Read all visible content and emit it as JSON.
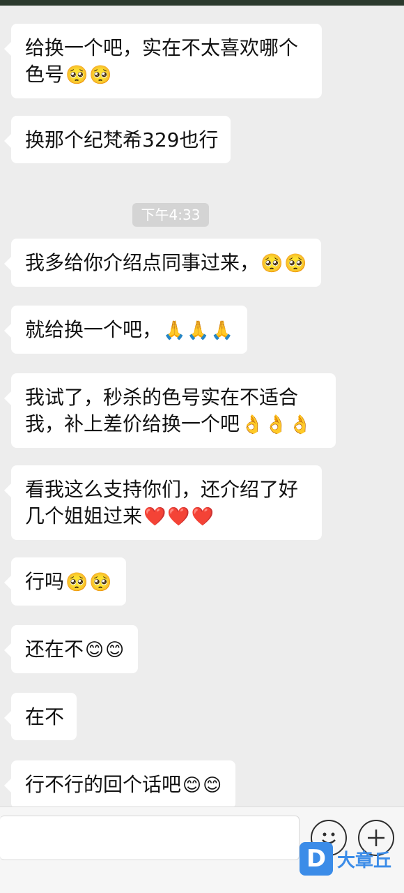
{
  "timestamp": "下午4:33",
  "messages": [
    {
      "text": "给换一个吧，实在不太喜欢哪个色号",
      "emoji": "🥺🥺"
    },
    {
      "text": "换那个纪梵希329也行",
      "emoji": ""
    },
    {
      "text": "我多给你介绍点同事过来，",
      "emoji": "🥺🥺"
    },
    {
      "text": "就给换一个吧，",
      "emoji": "🙏🙏🙏"
    },
    {
      "text": "我试了，秒杀的色号实在不适合我，补上差价给换一个吧",
      "emoji": "👌👌👌"
    },
    {
      "text": "看我这么支持你们，还介绍了好几个姐姐过来",
      "emoji": "❤️❤️❤️"
    },
    {
      "text": "行吗",
      "emoji": "🥺🥺"
    },
    {
      "text": "还在不",
      "emoji": "😊😊"
    },
    {
      "text": "在不",
      "emoji": ""
    },
    {
      "text": "行不行的回个话吧",
      "emoji": "😊😊"
    }
  ],
  "input": {
    "value": ""
  },
  "icons": {
    "emoji_button": "smiley-icon",
    "more_button": "plus-icon"
  },
  "watermark": {
    "text": "大章丘",
    "logo": "D"
  },
  "colors": {
    "background": "#ededed",
    "bubble": "#ffffff",
    "watermark": "#3b8ce8"
  }
}
